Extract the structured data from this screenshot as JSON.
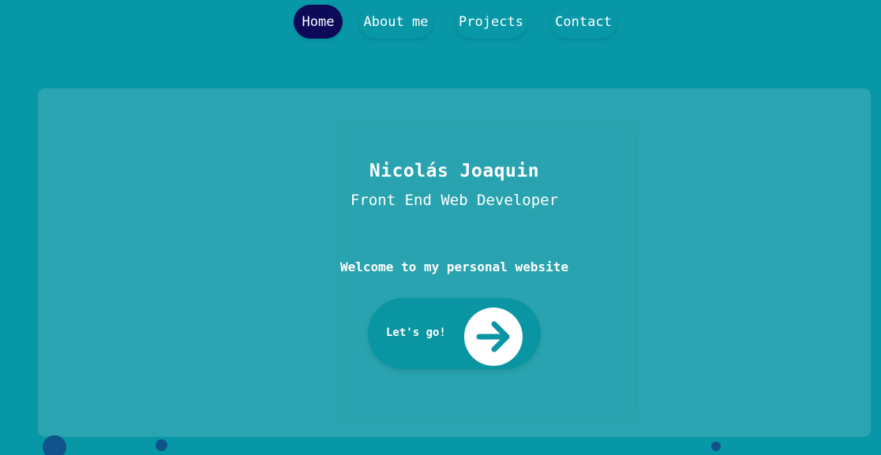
{
  "nav": {
    "items": [
      {
        "label": "Home",
        "active": true
      },
      {
        "label": "About me",
        "active": false
      },
      {
        "label": "Projects",
        "active": false
      },
      {
        "label": "Contact",
        "active": false
      }
    ]
  },
  "hero": {
    "name": "Nicolás Joaquin",
    "role": "Front End Web Developer",
    "welcome": "Welcome to my personal website",
    "cta_label": "Let's go!",
    "cta_icon": "arrow-right-icon"
  },
  "colors": {
    "background": "#0797a6",
    "card": "#2aa4b0",
    "active_nav": "#0e0a5a",
    "cta": "#0a95a3",
    "arrow": "#0a95a3",
    "dots": "#10538a"
  }
}
